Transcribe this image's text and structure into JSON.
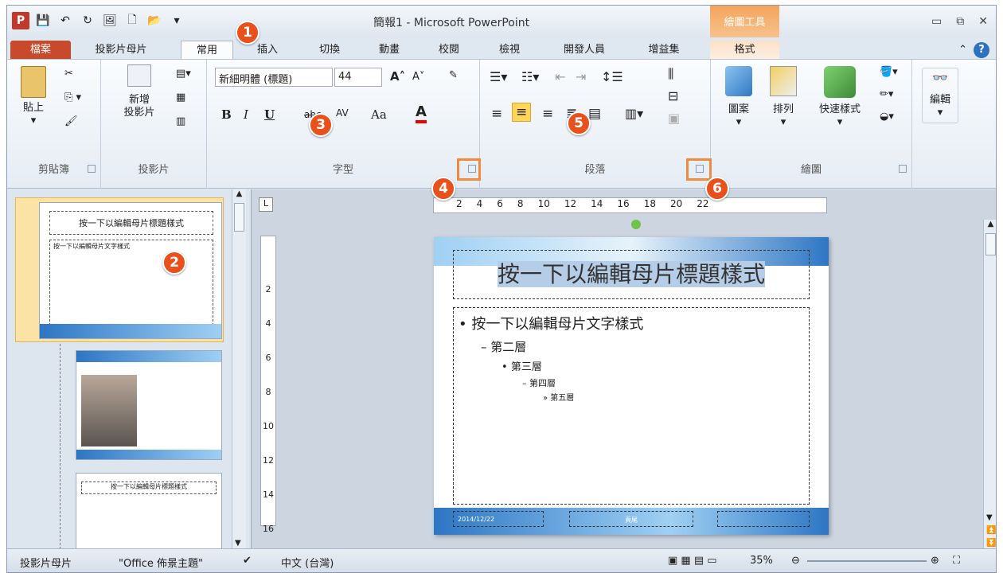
{
  "app": {
    "title": "簡報1 - Microsoft PowerPoint",
    "contextual_tab": "繪圖工具",
    "logo": "P"
  },
  "tabs": {
    "file": "檔案",
    "master": "投影片母片",
    "home": "常用",
    "insert": "插入",
    "transitions": "切換",
    "animations": "動畫",
    "review": "校閱",
    "view": "檢視",
    "developer": "開發人員",
    "addins": "增益集",
    "format": "格式"
  },
  "ribbon": {
    "clipboard": {
      "label": "剪貼簿",
      "paste": "貼上"
    },
    "slides": {
      "label": "投影片",
      "new_slide_1": "新增",
      "new_slide_2": "投影片"
    },
    "font": {
      "label": "字型",
      "name": "新細明體 (標題)",
      "size": "44",
      "bold": "B",
      "italic": "I",
      "underline": "U",
      "strike": "abc",
      "aa": "Aa",
      "spacing": "AV",
      "color": "A"
    },
    "paragraph": {
      "label": "段落"
    },
    "drawing": {
      "label": "繪圖",
      "shapes": "圖案",
      "arrange": "排列",
      "quick_styles": "快速樣式"
    },
    "editing": {
      "label": "編輯"
    }
  },
  "badges": [
    "1",
    "2",
    "3",
    "4",
    "5",
    "6"
  ],
  "slide": {
    "number": "1",
    "title": "按一下以編輯母片標題樣式",
    "body": "按一下以編輯母片文字樣式",
    "l2": "第二層",
    "l3": "第三層",
    "l4": "第四層",
    "l5": "第五層",
    "footer_mid": "頁尾",
    "footer_left": "2014/12/22"
  },
  "ruler": {
    "h": [
      "2",
      "4",
      "6",
      "8",
      "10",
      "12",
      "14",
      "16",
      "18",
      "20",
      "22"
    ],
    "v": [
      "2",
      "4",
      "6",
      "8",
      "10",
      "12",
      "14",
      "16"
    ]
  },
  "status": {
    "view": "投影片母片",
    "theme": "\"Office 佈景主題\"",
    "lang": "中文 (台灣)",
    "zoom": "35%"
  }
}
